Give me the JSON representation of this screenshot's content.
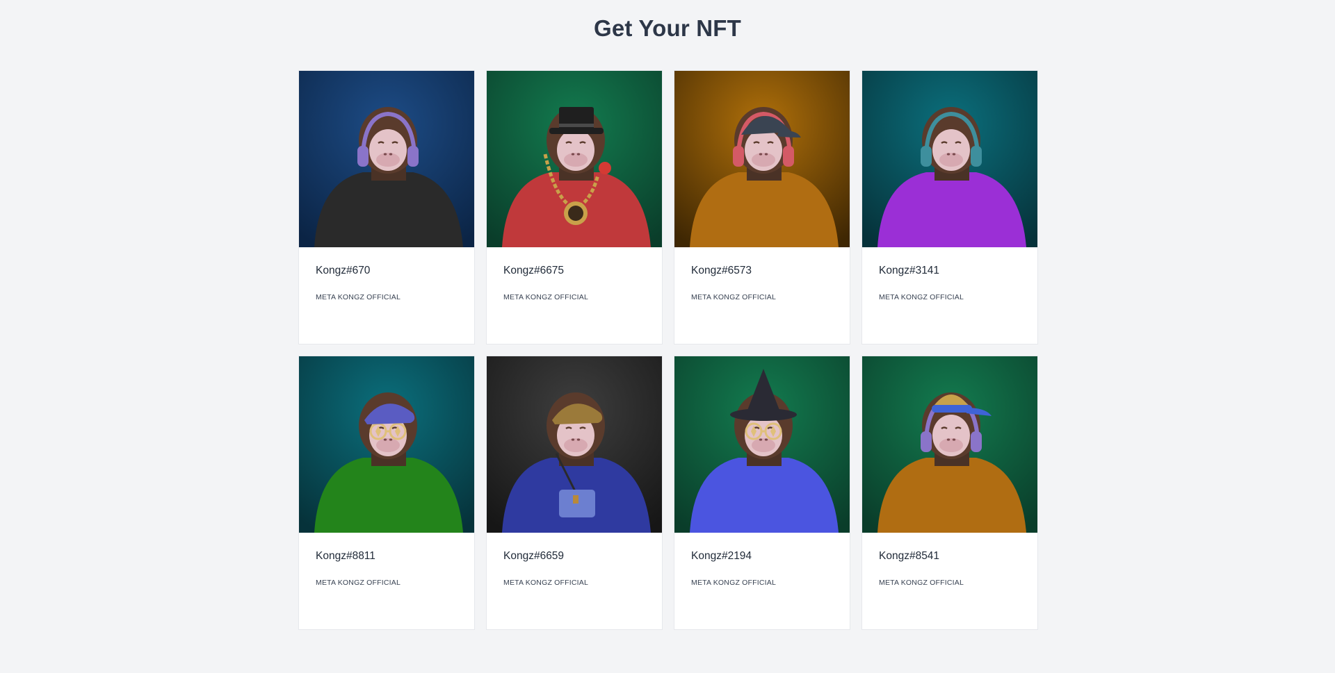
{
  "page": {
    "title": "Get Your NFT"
  },
  "cards": [
    {
      "name": "Kongz#670",
      "collection": "META KONGZ OFFICIAL",
      "bg_top": "#1d4c86",
      "bg_bottom": "#0b2445",
      "outfit": "#2a2a2a",
      "hat": "none",
      "hat_color": "#9b7bd6",
      "accessory": "headphones",
      "acc_color": "#8a74c9"
    },
    {
      "name": "Kongz#6675",
      "collection": "META KONGZ OFFICIAL",
      "bg_top": "#137b4f",
      "bg_bottom": "#0a3d2a",
      "outfit": "#c0393b",
      "hat": "tophat",
      "hat_color": "#1f1f1f",
      "accessory": "chain",
      "acc_color": "#c9a14a"
    },
    {
      "name": "Kongz#6573",
      "collection": "META KONGZ OFFICIAL",
      "bg_top": "#b0700a",
      "bg_bottom": "#3f2703",
      "outfit": "#b06d12",
      "hat": "cap",
      "hat_color": "#3a4452",
      "accessory": "headphones",
      "acc_color": "#d45a66"
    },
    {
      "name": "Kongz#3141",
      "collection": "META KONGZ OFFICIAL",
      "bg_top": "#0b6f7c",
      "bg_bottom": "#06323a",
      "outfit": "#9b2fd6",
      "hat": "none",
      "hat_color": "#9b7bd6",
      "accessory": "headphones",
      "acc_color": "#3e8f9d"
    },
    {
      "name": "Kongz#8811",
      "collection": "META KONGZ OFFICIAL",
      "bg_top": "#0b6f7c",
      "bg_bottom": "#06323a",
      "outfit": "#23841b",
      "hat": "flatcap",
      "hat_color": "#5a5cc2",
      "accessory": "glasses",
      "acc_color": "#e0c07a"
    },
    {
      "name": "Kongz#6659",
      "collection": "META KONGZ OFFICIAL",
      "bg_top": "#3e3e3e",
      "bg_bottom": "#161616",
      "outfit": "#2f3aa0",
      "hat": "flatcap",
      "hat_color": "#9b7a3a",
      "accessory": "bag",
      "acc_color": "#6c7fd0"
    },
    {
      "name": "Kongz#2194",
      "collection": "META KONGZ OFFICIAL",
      "bg_top": "#137b4f",
      "bg_bottom": "#0a3d2a",
      "outfit": "#4b55e0",
      "hat": "witch",
      "hat_color": "#2a2a34",
      "accessory": "glasses",
      "acc_color": "#e0c07a"
    },
    {
      "name": "Kongz#8541",
      "collection": "META KONGZ OFFICIAL",
      "bg_top": "#137b4f",
      "bg_bottom": "#0a3d2a",
      "outfit": "#b06d12",
      "hat": "visor",
      "hat_color": "#3f63d6",
      "accessory": "headphones",
      "acc_color": "#8a74c9"
    }
  ]
}
